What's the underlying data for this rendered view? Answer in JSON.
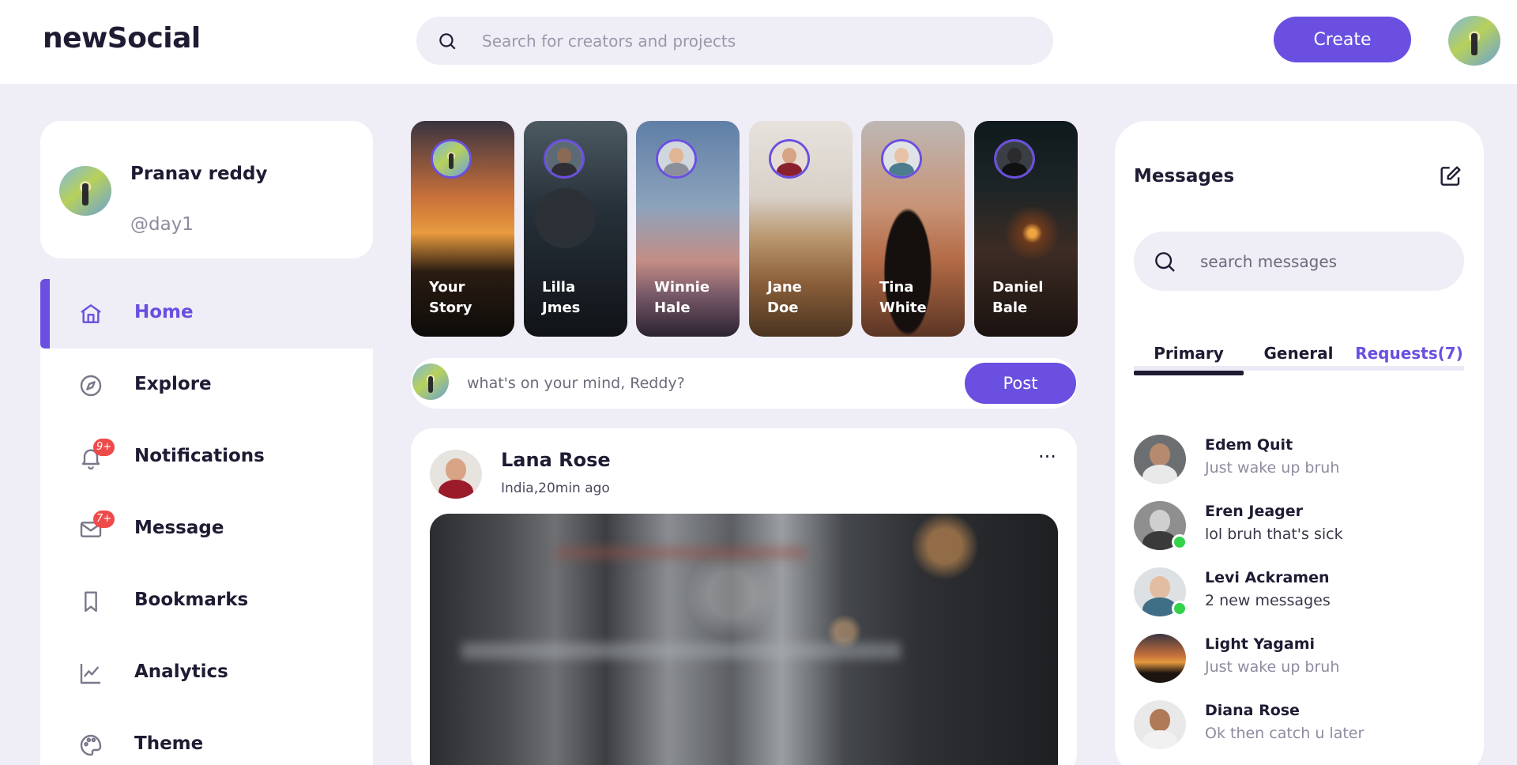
{
  "app": {
    "logo": "newSocial"
  },
  "header": {
    "search_placeholder": "Search for creators and projects",
    "create_label": "Create",
    "avatar": "user-avatar"
  },
  "profile": {
    "name": "Pranav reddy",
    "handle": "@day1"
  },
  "nav": {
    "items": [
      {
        "label": "Home",
        "icon": "home-icon",
        "active": true
      },
      {
        "label": "Explore",
        "icon": "compass-icon"
      },
      {
        "label": "Notifications",
        "icon": "bell-icon",
        "badge": "9+"
      },
      {
        "label": "Message",
        "icon": "mail-icon",
        "badge": "7+"
      },
      {
        "label": "Bookmarks",
        "icon": "bookmark-icon"
      },
      {
        "label": "Analytics",
        "icon": "chart-line-icon"
      },
      {
        "label": "Theme",
        "icon": "palette-icon"
      }
    ]
  },
  "stories": [
    {
      "line1": "Your",
      "line2": "Story"
    },
    {
      "line1": "Lilla",
      "line2": "Jmes"
    },
    {
      "line1": "Winnie",
      "line2": "Hale"
    },
    {
      "line1": "Jane",
      "line2": "Doe"
    },
    {
      "line1": "Tina",
      "line2": "White"
    },
    {
      "line1": "Daniel",
      "line2": "Bale"
    }
  ],
  "composer": {
    "placeholder": "what's on your mind, Reddy?",
    "post_label": "Post"
  },
  "feed": {
    "posts": [
      {
        "author": "Lana Rose",
        "meta": "India,20min ago",
        "more": "···"
      }
    ]
  },
  "messages": {
    "title": "Messages",
    "search_placeholder": "search messages",
    "tabs": [
      "Primary",
      "General",
      "Requests(7)"
    ],
    "active_tab": "Primary",
    "items": [
      {
        "name": "Edem Quit",
        "text": "Just wake up bruh",
        "online": false
      },
      {
        "name": "Eren Jeager",
        "text": "lol bruh that's sick",
        "online": true
      },
      {
        "name": "Levi Ackramen",
        "text": "2 new messages",
        "online": true
      },
      {
        "name": "Light Yagami",
        "text": "Just wake up bruh",
        "online": false
      },
      {
        "name": "Diana Rose",
        "text": "Ok then catch u later",
        "online": false
      }
    ]
  },
  "colors": {
    "accent": "#6a4fe0",
    "background": "#efedf6",
    "badge": "#ef4a4a",
    "online": "#34d24a"
  }
}
